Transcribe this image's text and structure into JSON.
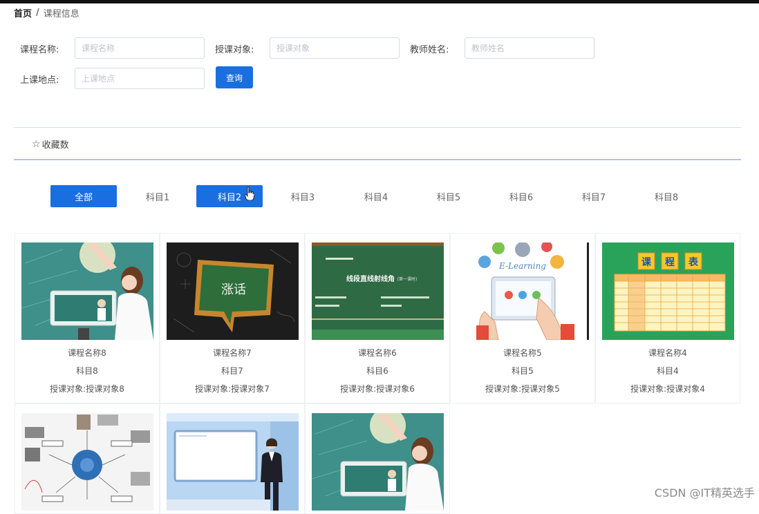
{
  "breadcrumb": {
    "home": "首页",
    "separator": "/",
    "current": "课程信息"
  },
  "search": {
    "course_name": {
      "label": "课程名称:",
      "placeholder": "课程名称"
    },
    "audience": {
      "label": "授课对象:",
      "placeholder": "授课对象"
    },
    "teacher": {
      "label": "教师姓名:",
      "placeholder": "教师姓名"
    },
    "location": {
      "label": "上课地点:",
      "placeholder": "上课地点"
    },
    "query_label": "查询"
  },
  "sort": {
    "icon": "star-outline-icon",
    "label": "收藏数"
  },
  "categories": [
    {
      "label": "全部",
      "active": true
    },
    {
      "label": "科目1",
      "active": false
    },
    {
      "label": "科目2",
      "active": true
    },
    {
      "label": "科目3",
      "active": false
    },
    {
      "label": "科目4",
      "active": false
    },
    {
      "label": "科目5",
      "active": false
    },
    {
      "label": "科目6",
      "active": false
    },
    {
      "label": "科目7",
      "active": false
    },
    {
      "label": "科目8",
      "active": false
    }
  ],
  "courses": [
    {
      "name": "课程名称8",
      "subject": "科目8",
      "audience": "授课对象:授课对象8",
      "thumb": "teacher-classroom"
    },
    {
      "name": "课程名称7",
      "subject": "科目7",
      "audience": "授课对象:授课对象7",
      "thumb": "chalkboard-speech-bubble"
    },
    {
      "name": "课程名称6",
      "subject": "科目6",
      "audience": "授课对象:授课对象6",
      "thumb": "green-blackboard-lesson"
    },
    {
      "name": "课程名称5",
      "subject": "科目5",
      "audience": "授课对象:授课对象5",
      "thumb": "e-learning-tablet"
    },
    {
      "name": "课程名称4",
      "subject": "科目4",
      "audience": "授课对象:授课对象4",
      "thumb": "timetable"
    },
    {
      "name": "",
      "subject": "",
      "audience": "",
      "thumb": "mind-map"
    },
    {
      "name": "",
      "subject": "",
      "audience": "",
      "thumb": "presenter-whiteboard"
    },
    {
      "name": "",
      "subject": "",
      "audience": "",
      "thumb": "teacher-classroom"
    }
  ],
  "thumb_texts": {
    "chalkboard": "涨话",
    "blackboard_title": "线段直线射线角",
    "blackboard_sub": "(第一课时)",
    "elearning": "E-Learning",
    "timetable": [
      "课",
      "程",
      "表"
    ]
  },
  "colors": {
    "primary": "#1a6fe0",
    "divider": "#a9c8ef",
    "chalk_green": "#2e6b45",
    "timetable_green": "#2aa35a"
  },
  "watermark": "CSDN @IT精英选手"
}
